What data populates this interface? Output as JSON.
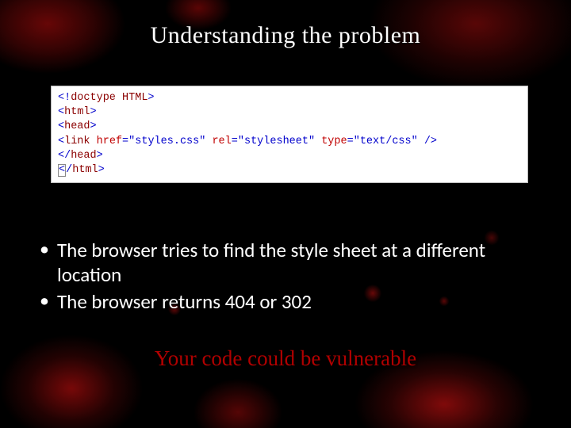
{
  "title": "Understanding the problem",
  "bullets": {
    "b3": "The browser tries to find the style sheet at a different location",
    "b4": "The browser returns 404 or 302"
  },
  "code": {
    "l1_open": "<!",
    "l1_name": "doctype HTML",
    "l1_close": ">",
    "l2_open": "<",
    "l2_name": "html",
    "l2_close": ">",
    "l3_open": "<",
    "l3_name": "head",
    "l3_close": ">",
    "l4_open": "<",
    "l4_name": "link",
    "l4_a1": " href",
    "l4_eq1": "=",
    "l4_v1": "\"styles.css\"",
    "l4_a2": " rel",
    "l4_eq2": "=",
    "l4_v2": "\"stylesheet\"",
    "l4_a3": " type",
    "l4_eq3": "=",
    "l4_v3": "\"text/css\"",
    "l4_close": " />",
    "l5_open": "</",
    "l5_name": "head",
    "l5_close": ">",
    "l6_caret_open": "<",
    "l6_caret_close": "/",
    "l6_name": "html",
    "l6_close": ">"
  },
  "closing": "Your code could be vulnerable"
}
